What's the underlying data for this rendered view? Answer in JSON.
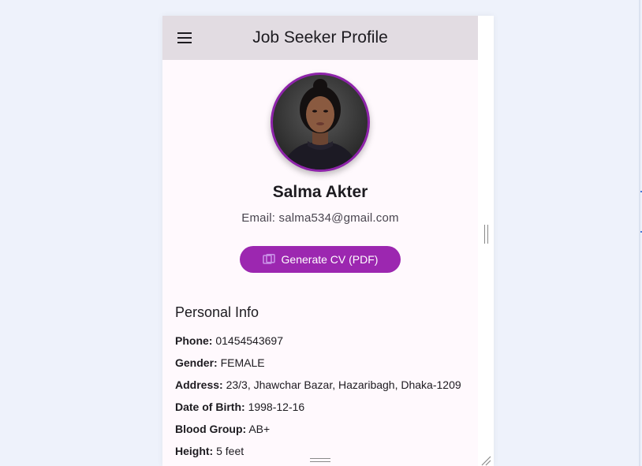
{
  "appbar": {
    "title": "Job Seeker Profile",
    "menu_icon": "menu-icon"
  },
  "profile": {
    "name": "Salma Akter",
    "email": "Email: salma534@gmail.com",
    "avatar_icon": "profile-photo"
  },
  "actions": {
    "generate_cv_label": "Generate CV (PDF)",
    "generate_cv_icon": "document-icon"
  },
  "personal_info": {
    "title": "Personal Info",
    "rows": [
      {
        "label": "Phone:",
        "value": "01454543697"
      },
      {
        "label": "Gender:",
        "value": "FEMALE"
      },
      {
        "label": "Address:",
        "value": "23/3, Jhawchar Bazar, Hazaribagh, Dhaka-1209"
      },
      {
        "label": "Date of Birth:",
        "value": "1998-12-16"
      },
      {
        "label": "Blood Group:",
        "value": "AB+"
      },
      {
        "label": "Height:",
        "value": "5 feet"
      }
    ]
  },
  "colors": {
    "appbar_bg": "#e2dce2",
    "accent": "#9c27b0",
    "avatar_ring": "#8e24aa",
    "page_bg": "#fff9fd"
  }
}
